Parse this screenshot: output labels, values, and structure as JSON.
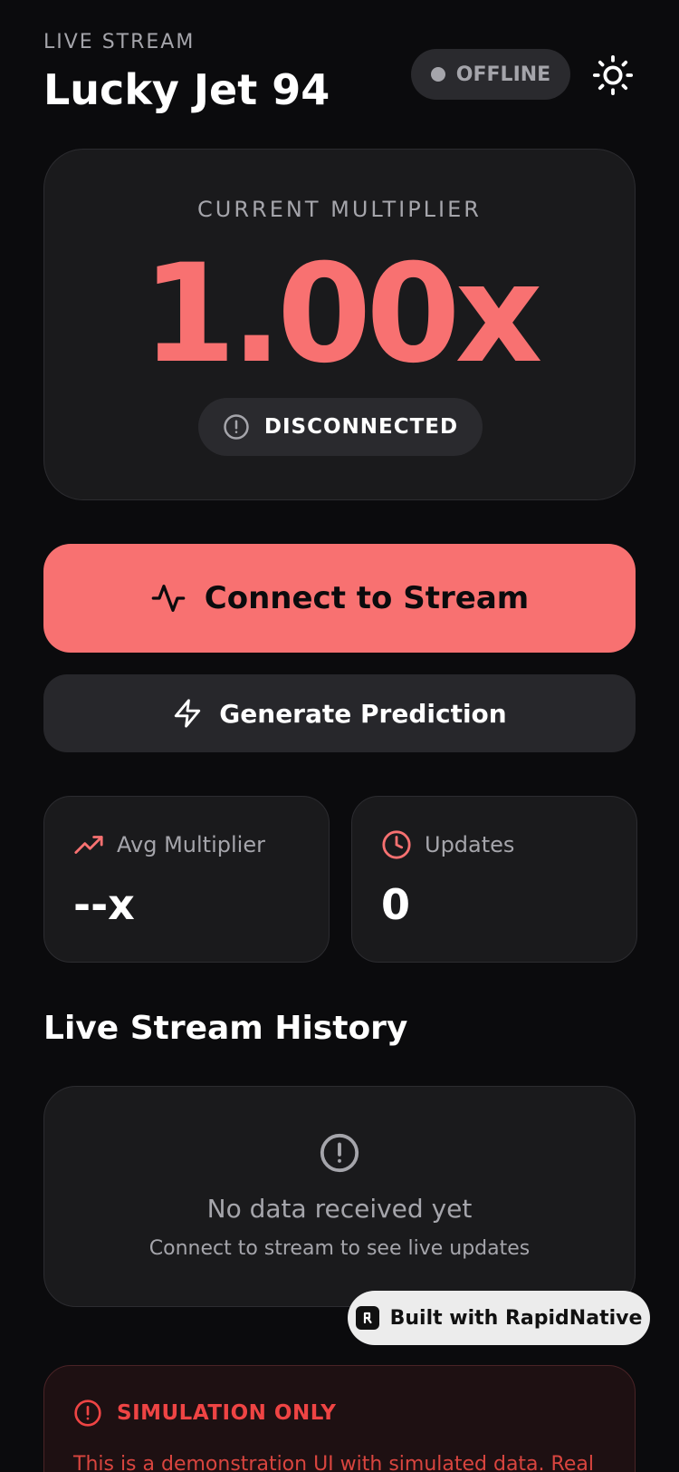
{
  "header": {
    "eyebrow": "LIVE STREAM",
    "title": "Lucky Jet 94",
    "status": "OFFLINE"
  },
  "multiplier": {
    "label": "CURRENT MULTIPLIER",
    "value": "1.00x",
    "connection_status": "DISCONNECTED"
  },
  "actions": {
    "connect_label": "Connect to Stream",
    "predict_label": "Generate Prediction"
  },
  "stats": {
    "avg": {
      "label": "Avg Multiplier",
      "value": "--x"
    },
    "updates": {
      "label": "Updates",
      "value": "0"
    }
  },
  "history": {
    "title": "Live Stream History",
    "empty_title": "No data received yet",
    "empty_subtitle": "Connect to stream to see live updates"
  },
  "badge": {
    "label": "Built with RapidNative"
  },
  "warning": {
    "title": "SIMULATION ONLY",
    "text": "This is a demonstration UI with simulated data. Real"
  },
  "colors": {
    "accent": "#f87171",
    "background": "#0b0b0d",
    "card": "#1a1a1c",
    "warning": "#ef4444"
  },
  "icons": {
    "theme": "sun-icon",
    "connection": "alert-circle-icon",
    "connect": "activity-icon",
    "predict": "lightning-icon",
    "avg": "trending-up-icon",
    "updates": "clock-icon",
    "history_empty": "alert-circle-icon",
    "warning": "alert-circle-icon"
  }
}
